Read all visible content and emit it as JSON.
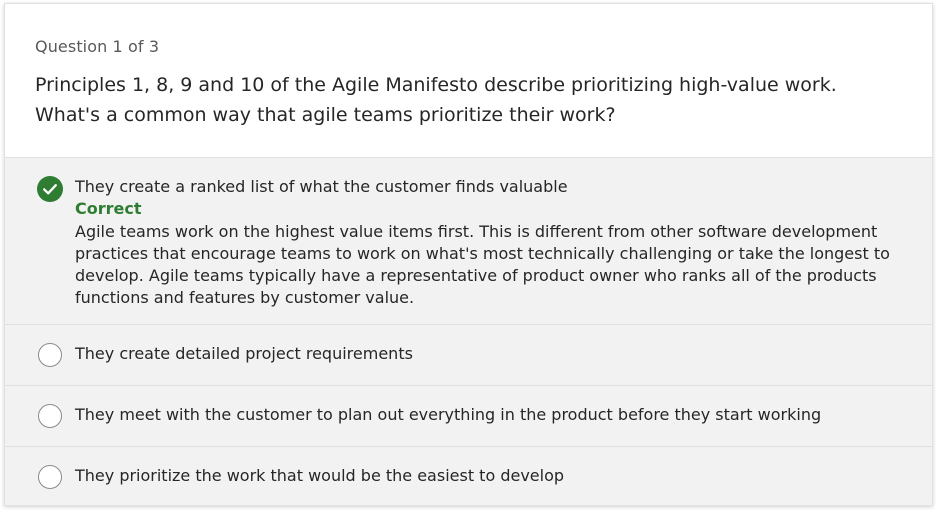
{
  "quiz": {
    "counter": "Question 1 of 3",
    "question": "Principles 1, 8, 9 and 10 of the Agile Manifesto describe prioritizing high-value work. What's a common way that agile teams prioritize their work?",
    "options": [
      {
        "label": "They create a ranked list of what the customer finds valuable",
        "state": "selected-correct",
        "feedback_title": "Correct",
        "feedback_body": "Agile teams work on the highest value items first. This is different from other software development practices that encourage teams to work on what's most technically challenging or take the longest to develop. Agile teams typically have a representative of product owner who ranks all of the products functions and features by customer value."
      },
      {
        "label": "They create detailed project requirements",
        "state": "unselected"
      },
      {
        "label": "They meet with the customer to plan out everything in the product before they start working",
        "state": "unselected"
      },
      {
        "label": "They prioritize the work that would be the easiest to develop",
        "state": "unselected"
      }
    ]
  },
  "colors": {
    "correct": "#2e7d32",
    "options_background": "#f2f2f2",
    "text": "#262626"
  },
  "icons": {
    "correct_icon": "check-circle-icon",
    "radio_icon": "radio-empty-icon"
  }
}
